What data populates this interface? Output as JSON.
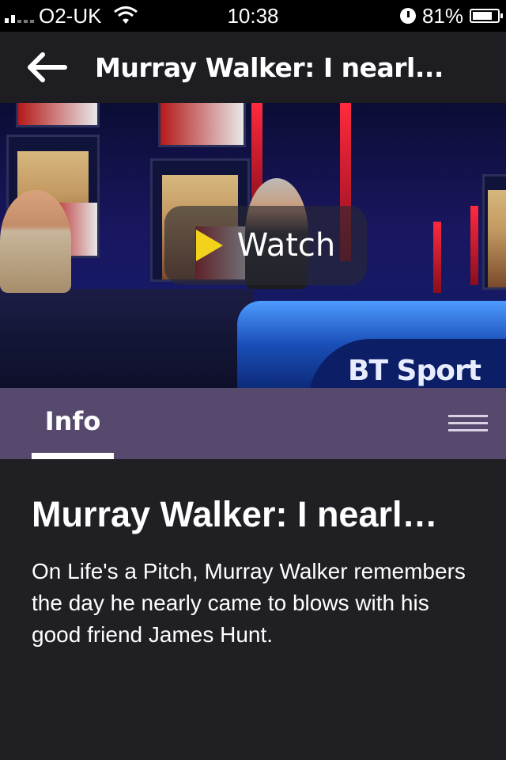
{
  "status_bar": {
    "carrier": "O2-UK",
    "time": "10:38",
    "battery": "81%",
    "battery_level": 0.81,
    "icons": [
      "signal-icon",
      "wifi-icon",
      "alarm-clock-icon",
      "battery-icon"
    ]
  },
  "header": {
    "back_icon": "back-arrow-icon",
    "title": "Murray Walker: I nearl..."
  },
  "hero": {
    "watch_label": "Watch",
    "play_icon": "play-icon",
    "brand_logo_text": "BT Sport"
  },
  "tabs": {
    "active": "Info",
    "menu_icon": "menu-icon"
  },
  "content": {
    "title": "Murray Walker: I nearl…",
    "description": "On Life's a Pitch, Murray Walker remembers the day he nearly came to blows with his good friend James Hunt."
  },
  "colors": {
    "status_bar_bg": "#000000",
    "header_bg": "#1d1d22",
    "tab_bar_bg": "#57496d",
    "page_bg": "#1f1f24",
    "play_accent": "#f3d21b"
  }
}
